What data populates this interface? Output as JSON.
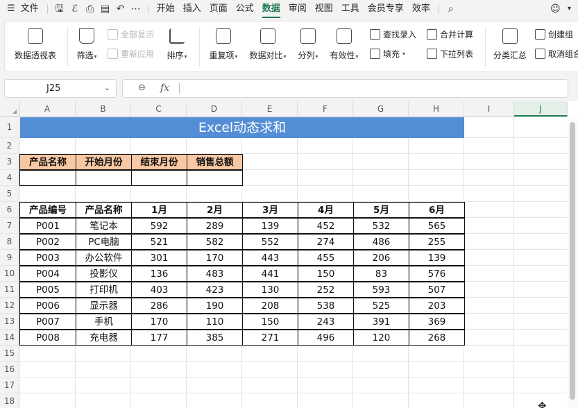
{
  "menubar": {
    "file": "文件",
    "icons": [
      "save-icon",
      "brush-icon",
      "print-icon",
      "print-preview-icon",
      "undo-icon",
      "more-icon"
    ],
    "more": "⋯",
    "tabs": [
      "开始",
      "插入",
      "页面",
      "公式",
      "数据",
      "审阅",
      "视图",
      "工具",
      "会员专享",
      "效率"
    ],
    "active_tab": "数据"
  },
  "ribbon": {
    "pivot": "数据透视表",
    "filter": "筛选",
    "show_all": "全部显示",
    "reapply": "重新应用",
    "sort": "排序",
    "duplicates": "重复项",
    "compare": "数据对比",
    "split": "分列",
    "validity": "有效性",
    "lookup": "查找录入",
    "fill": "填充",
    "consolidate": "合并计算",
    "dropdown": "下拉列表",
    "subtotal": "分类汇总",
    "create_group": "创建组",
    "ungroup": "取消组合"
  },
  "formula_bar": {
    "name_box": "J25",
    "fx": "fx",
    "formula": ""
  },
  "grid": {
    "columns": [
      "A",
      "B",
      "C",
      "D",
      "E",
      "F",
      "G",
      "H",
      "I",
      "J"
    ],
    "selected_column": "J",
    "rows": [
      "1",
      "2",
      "3",
      "4",
      "5",
      "6",
      "7",
      "8",
      "9",
      "10",
      "11",
      "12",
      "13",
      "14",
      "15",
      "16",
      "17",
      "18"
    ]
  },
  "sheet": {
    "title": "Excel动态求和",
    "criteria_headers": [
      "产品名称",
      "开始月份",
      "结束月份",
      "销售总额"
    ],
    "criteria_values": [
      "",
      "",
      "",
      ""
    ],
    "table_headers": [
      "产品编号",
      "产品名称",
      "1月",
      "2月",
      "3月",
      "4月",
      "5月",
      "6月"
    ],
    "table_rows": [
      [
        "P001",
        "笔记本",
        "592",
        "289",
        "139",
        "452",
        "532",
        "565"
      ],
      [
        "P002",
        "PC电脑",
        "521",
        "582",
        "552",
        "274",
        "486",
        "255"
      ],
      [
        "P003",
        "办公软件",
        "301",
        "170",
        "443",
        "455",
        "206",
        "139"
      ],
      [
        "P004",
        "投影仪",
        "136",
        "483",
        "441",
        "150",
        "83",
        "576"
      ],
      [
        "P005",
        "打印机",
        "403",
        "423",
        "130",
        "252",
        "593",
        "507"
      ],
      [
        "P006",
        "显示器",
        "286",
        "190",
        "208",
        "538",
        "525",
        "203"
      ],
      [
        "P007",
        "手机",
        "170",
        "110",
        "150",
        "243",
        "391",
        "369"
      ],
      [
        "P008",
        "充电器",
        "177",
        "385",
        "271",
        "496",
        "120",
        "268"
      ]
    ]
  },
  "colors": {
    "accent": "#1f7a4d",
    "title_band": "#538dd5",
    "criteria_fill": "#f8c7a3"
  }
}
